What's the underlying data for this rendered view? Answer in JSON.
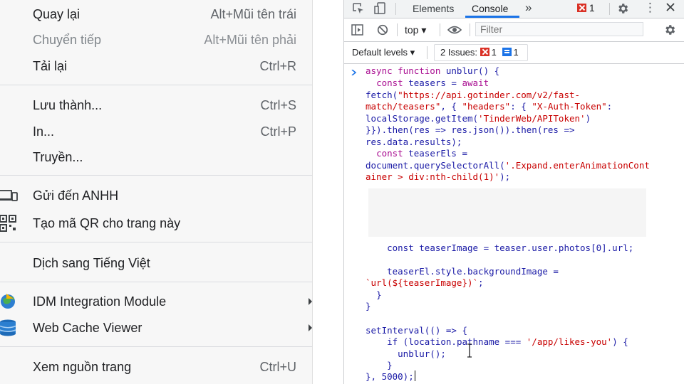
{
  "context_menu": {
    "items": [
      {
        "label": "Quay lại",
        "shortcut": "Alt+Mũi tên trái"
      },
      {
        "label": "Chuyển tiếp",
        "shortcut": "Alt+Mũi tên phải"
      },
      {
        "label": "Tải lại",
        "shortcut": "Ctrl+R"
      },
      {
        "label": "Lưu thành...",
        "shortcut": "Ctrl+S"
      },
      {
        "label": "In...",
        "shortcut": "Ctrl+P"
      },
      {
        "label": "Truyền..."
      },
      {
        "label": "Gửi đến ANHH",
        "icon": "devices-icon"
      },
      {
        "label": "Tạo mã QR cho trang này",
        "icon": "qr-code-icon"
      },
      {
        "label": "Dịch sang Tiếng Việt"
      },
      {
        "label": "IDM Integration Module",
        "icon": "idm-globe-icon"
      },
      {
        "label": "Web Cache Viewer",
        "icon": "database-icon"
      },
      {
        "label": "Xem nguồn trang",
        "shortcut": "Ctrl+U"
      }
    ]
  },
  "devtools": {
    "tabs": {
      "elements": "Elements",
      "console": "Console",
      "more": "»"
    },
    "error_count": "1",
    "context": "top ▾",
    "filter_placeholder": "Filter",
    "levels": "Default levels ▾",
    "issues": {
      "label": "2 Issues:",
      "errors": "1",
      "infos": "1"
    },
    "accent": "#1a73e8",
    "error_color": "#d93025"
  },
  "console": {
    "code": {
      "l1": {
        "kw": "async function",
        "rest": " unblur() {"
      },
      "l2": {
        "kw": "const",
        "mid": " teasers = ",
        "kw2": "await"
      },
      "l3": {
        "fn": "fetch(",
        "str": "\"https://api.gotinder.com/v2/fast-"
      },
      "l4": {
        "str1": "match/teasers\"",
        "mid": ", { ",
        "str2": "\"headers\"",
        "mid2": ": { ",
        "str3": "\"X-Auth-Token\"",
        "end": ":"
      },
      "l5": {
        "a": "localStorage.getItem(",
        "str": "'TinderWeb/APIToken'",
        "b": ")"
      },
      "l6": {
        "text": "}}).then(res => res.json()).then(res =>"
      },
      "l7": {
        "text": "res.data.results);"
      },
      "l8": {
        "kw": "const",
        "rest": " teaserEls ="
      },
      "l9": {
        "a": "document.querySelectorAll(",
        "str": "'.Expand.enterAnimationCont"
      },
      "l10": {
        "str": "ainer > div:nth-child(1)'",
        "b": ");"
      },
      "l11": {
        "text": "const teaserImage = teaser.user.photos[0].url;"
      },
      "l12": {
        "text": "teaserEl.style.backgroundImage ="
      },
      "l13": {
        "str": "`url(${teaserImage})`",
        "b": ";"
      },
      "l14": {
        "text": "}"
      },
      "l15": {
        "text": "}"
      },
      "l16": {
        "text": "setInterval(() => {"
      },
      "l17": {
        "a": "if (location.pathname === ",
        "str": "'/app/likes-you'",
        "b": ") {"
      },
      "l18": {
        "text": "unblur();"
      },
      "l19": {
        "text": "}"
      },
      "l20": {
        "text": "}, 5000);"
      }
    }
  }
}
